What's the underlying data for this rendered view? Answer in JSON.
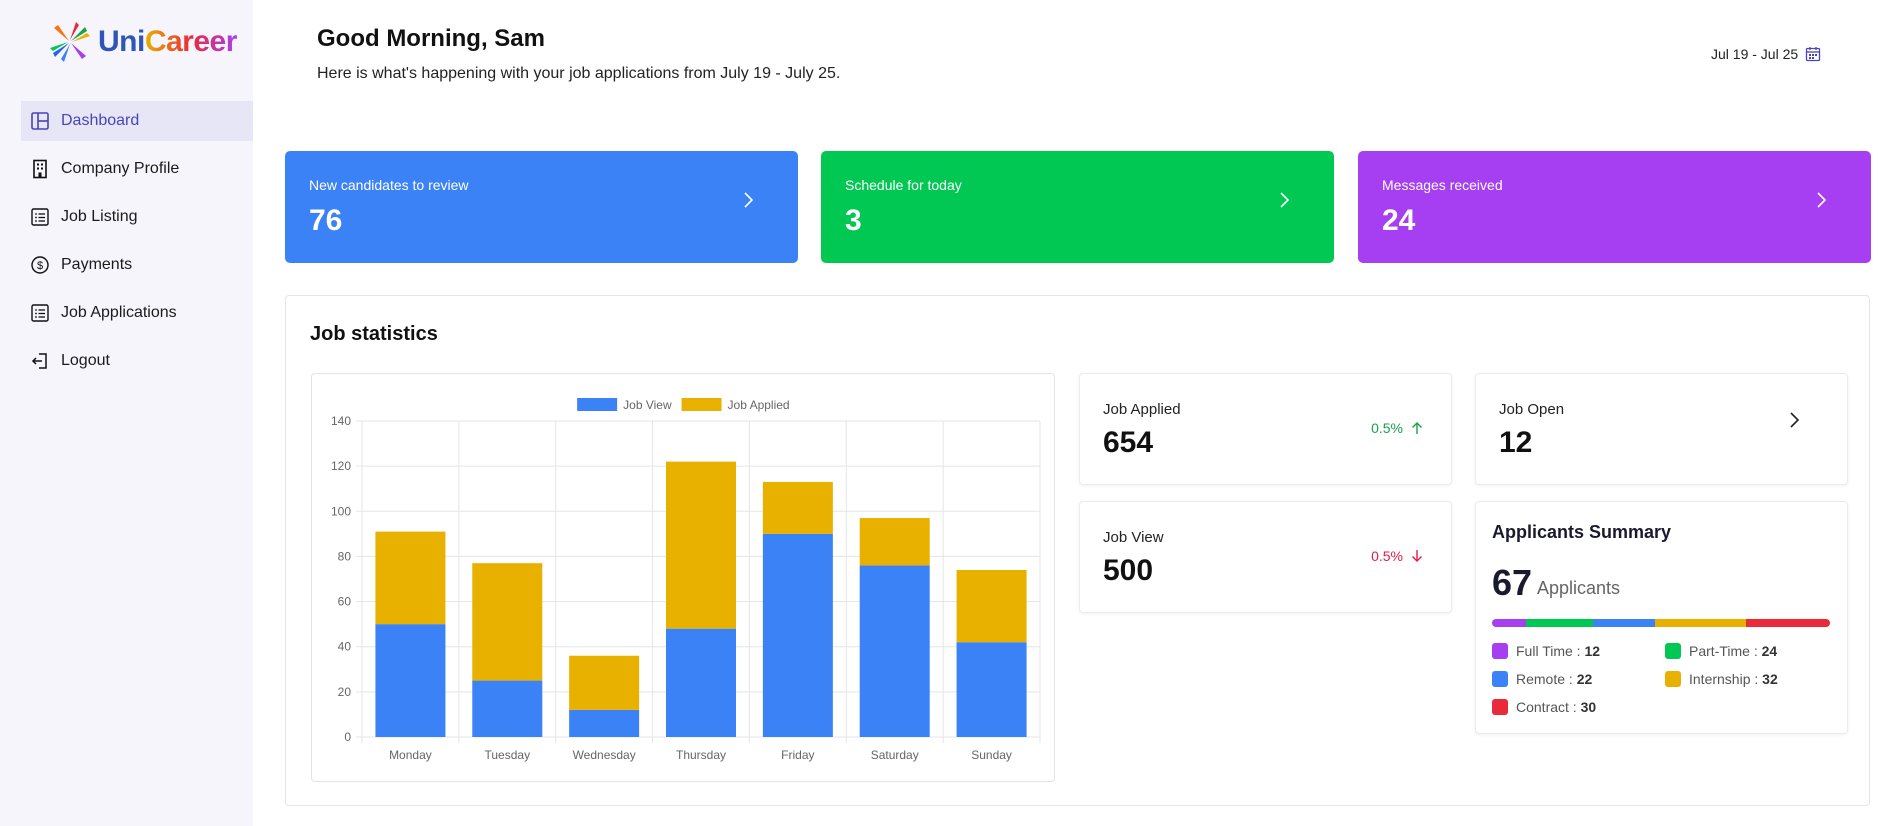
{
  "brand": {
    "name_part1": "Uni",
    "name_part2": "Career"
  },
  "sidebar": {
    "items": [
      {
        "label": "Dashboard",
        "icon": "dashboard-icon"
      },
      {
        "label": "Company Profile",
        "icon": "building-icon"
      },
      {
        "label": "Job Listing",
        "icon": "list-icon"
      },
      {
        "label": "Payments",
        "icon": "dollar-icon"
      },
      {
        "label": "Job Applications",
        "icon": "list-icon"
      },
      {
        "label": "Logout",
        "icon": "logout-icon"
      }
    ]
  },
  "header": {
    "greeting": "Good Morning, Sam",
    "subtitle": "Here is what's happening with your job applications from July 19 - July 25.",
    "date_range": "Jul 19 - Jul 25"
  },
  "cards": [
    {
      "label": "New candidates to review",
      "value": "76",
      "color": "#3b82f6"
    },
    {
      "label": "Schedule for today",
      "value": "3",
      "color": "#00c853"
    },
    {
      "label": "Messages received",
      "value": "24",
      "color": "#a63ff2"
    }
  ],
  "stats": {
    "title": "Job statistics",
    "job_applied": {
      "label": "Job Applied",
      "value": "654",
      "change": "0.5%",
      "direction": "up"
    },
    "job_view": {
      "label": "Job View",
      "value": "500",
      "change": "0.5%",
      "direction": "down"
    },
    "job_open": {
      "label": "Job Open",
      "value": "12"
    }
  },
  "summary": {
    "title": "Applicants Summary",
    "count": "67",
    "unit": "Applicants",
    "items": [
      {
        "label": "Full Time :",
        "value": "12",
        "color": "#a63ff2"
      },
      {
        "label": "Part-Time :",
        "value": "24",
        "color": "#00c853"
      },
      {
        "label": "Remote :",
        "value": "22",
        "color": "#3b82f6"
      },
      {
        "label": "Internship :",
        "value": "32",
        "color": "#e8b100"
      },
      {
        "label": "Contract :",
        "value": "30",
        "color": "#ea2a3a"
      }
    ]
  },
  "colors": {
    "accent": "#4a44b8",
    "up": "#16a34a",
    "down": "#e11d48"
  },
  "chart_data": {
    "type": "bar",
    "stacked": true,
    "categories": [
      "Monday",
      "Tuesday",
      "Wednesday",
      "Thursday",
      "Friday",
      "Saturday",
      "Sunday"
    ],
    "series": [
      {
        "name": "Job View",
        "color": "#3b82f6",
        "values": [
          50,
          25,
          12,
          48,
          90,
          76,
          42
        ]
      },
      {
        "name": "Job Applied",
        "color": "#e8b100",
        "values": [
          41,
          52,
          24,
          74,
          23,
          21,
          32
        ]
      }
    ],
    "ylim": [
      0,
      140
    ],
    "yticks": [
      "0",
      "20",
      "40",
      "60",
      "80",
      "100",
      "120",
      "140"
    ],
    "grid": true,
    "legend": "top-center"
  }
}
